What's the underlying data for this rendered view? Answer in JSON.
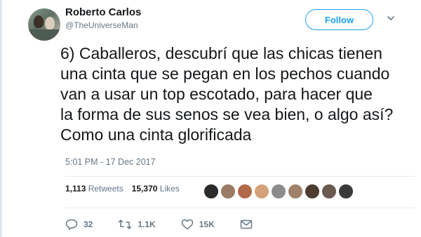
{
  "author": {
    "name": "Roberto Carlos",
    "handle": "@TheUniverseMan"
  },
  "follow_label": "Follow",
  "tweet_lines": [
    "6) Caballeros, descubrí que las chicas tienen",
    "una cinta que se pegan en los pechos cuando",
    "van a usar un top escotado, para hacer que",
    "la forma de sus senos se vea bien, o algo así?",
    "Como una cinta glorificada"
  ],
  "timestamp": "5:01 PM - 17 Dec 2017",
  "stats": {
    "retweets_count": "1,113",
    "retweets_label": "Retweets",
    "likes_count": "15,370",
    "likes_label": "Likes"
  },
  "liker_avatar_colors": [
    "#2b2b2b",
    "#9a7b63",
    "#b06a4a",
    "#d4a27a",
    "#8c8c8c",
    "#a0826a",
    "#4d3b30",
    "#6b5a4f",
    "#3a3a3a"
  ],
  "actions": {
    "replies": "32",
    "retweets": "1.1K",
    "likes": "15K"
  },
  "colors": {
    "accent": "#1da1f2",
    "secondary_text": "#657786",
    "text": "#14171a"
  }
}
